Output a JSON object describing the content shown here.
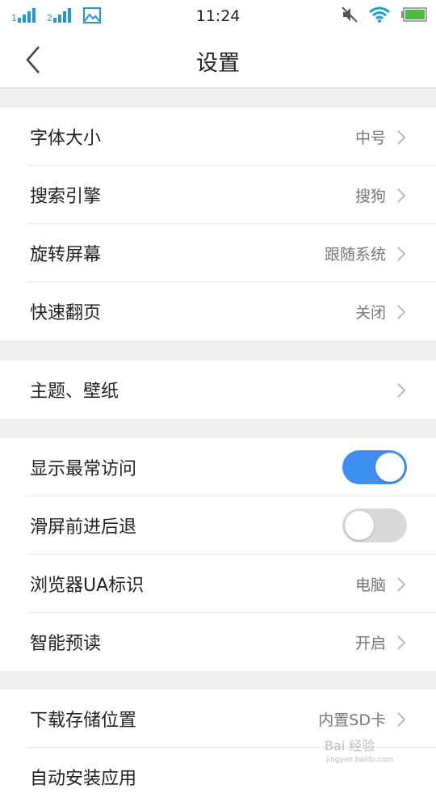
{
  "status_bar": {
    "time": "11:24",
    "icons": [
      "signal-1-icon",
      "signal-2-icon",
      "gallery-icon",
      "mute-icon",
      "wifi-icon",
      "battery-icon"
    ]
  },
  "nav": {
    "title": "设置",
    "back_icon": "back-arrow-icon"
  },
  "groups": [
    {
      "items": [
        {
          "label": "字体大小",
          "value": "中号"
        },
        {
          "label": "搜索引擎",
          "value": "搜狗"
        },
        {
          "label": "旋转屏幕",
          "value": "跟随系统"
        },
        {
          "label": "快速翻页",
          "value": "关闭"
        }
      ]
    },
    {
      "items": [
        {
          "label": "主题、壁纸",
          "value": ""
        }
      ]
    },
    {
      "items": [
        {
          "label": "显示最常访问",
          "toggle": true
        },
        {
          "label": "滑屏前进后退",
          "toggle": false
        },
        {
          "label": "浏览器UA标识",
          "value": "电脑"
        },
        {
          "label": "智能预读",
          "value": "开启"
        }
      ]
    },
    {
      "items": [
        {
          "label": "下载存储位置",
          "value": "内置SD卡"
        },
        {
          "label": "自动安装应用",
          "value": ""
        }
      ]
    }
  ],
  "watermark": {
    "brand": "Bai 经验",
    "url": "jingyan.baidu.com"
  },
  "colors": {
    "accent": "#3d8ff2",
    "toggle_off": "#d9d9d9",
    "status_icons": "#1f9ad6",
    "battery": "#4cbb3f",
    "background": "#efeff0"
  }
}
